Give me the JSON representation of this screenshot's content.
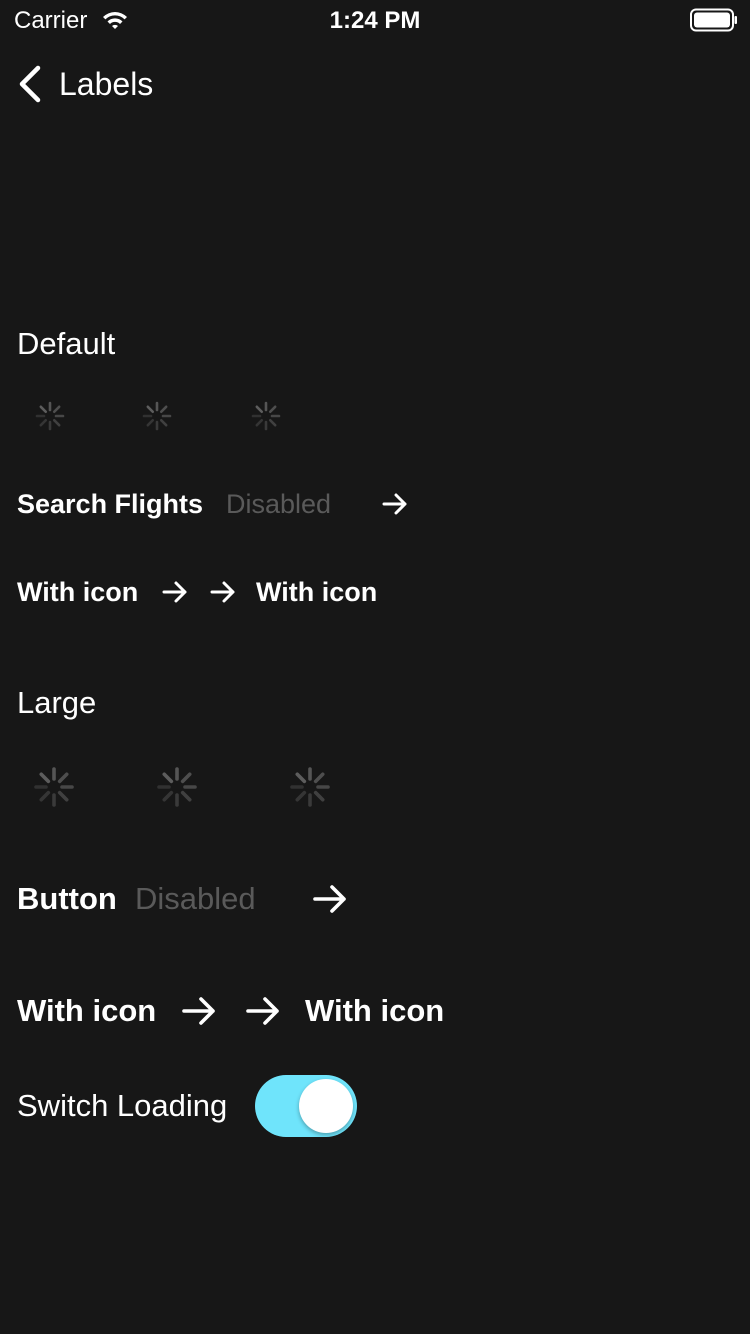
{
  "status_bar": {
    "carrier": "Carrier",
    "time": "1:24 PM"
  },
  "nav": {
    "title": "Labels",
    "back_icon": "chevron-left-icon"
  },
  "default_section": {
    "title": "Default",
    "button_label": "Search Flights",
    "disabled_label": "Disabled",
    "icon_left_label": "With icon",
    "icon_right_label": "With icon"
  },
  "large_section": {
    "title": "Large",
    "button_label": "Button",
    "disabled_label": "Disabled",
    "icon_left_label": "With icon",
    "icon_right_label": "With icon"
  },
  "switch": {
    "label": "Switch Loading",
    "on": true,
    "color": "#6fe4fb"
  },
  "colors": {
    "background": "#171717",
    "text": "#ffffff",
    "disabled": "#5a5a5a"
  }
}
